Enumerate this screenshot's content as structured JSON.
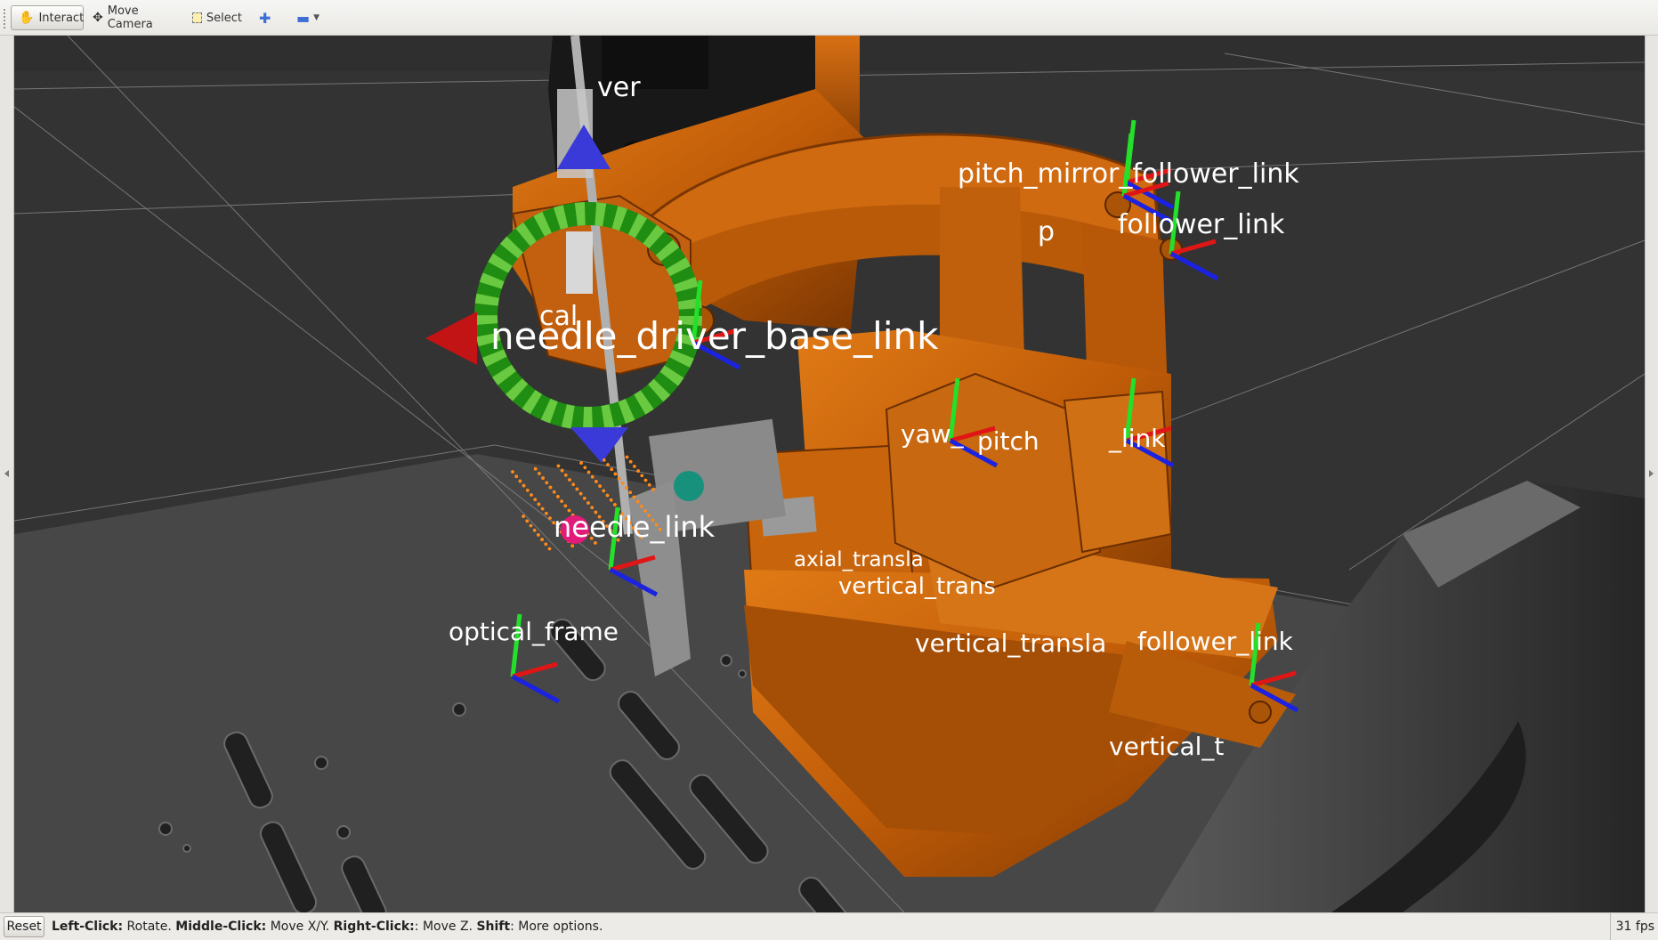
{
  "toolbar": {
    "tools": [
      {
        "label": "Interact",
        "icon": "hand-icon",
        "active": true
      },
      {
        "label": "Move Camera",
        "icon": "move-camera-icon",
        "active": false
      },
      {
        "label": "Select",
        "icon": "select-box-icon",
        "active": false
      }
    ],
    "add_tool_icon": "plus-icon",
    "remove_tool_icon": "minus-icon"
  },
  "viewport": {
    "background_color": "#2f2f2f",
    "robot_color": "#c8640a",
    "frame_labels": [
      {
        "text": "ver"
      },
      {
        "text": "pitch_mirror_follower_link"
      },
      {
        "text": "p"
      },
      {
        "text": "follower_link"
      },
      {
        "text": "cal"
      },
      {
        "text": "needle_driver_base_link"
      },
      {
        "text": "yaw_"
      },
      {
        "text": "pitch"
      },
      {
        "text": "_link"
      },
      {
        "text": "needle_link"
      },
      {
        "text": "axial_transla"
      },
      {
        "text": "vertical_trans"
      },
      {
        "text": "optical_frame"
      },
      {
        "text": "vertical_transla"
      },
      {
        "text": "follower_link"
      },
      {
        "text": "vertical_t"
      }
    ]
  },
  "statusbar": {
    "reset_label": "Reset",
    "left_click_key": "Left-Click:",
    "left_click_action": " Rotate. ",
    "middle_click_key": "Middle-Click:",
    "middle_click_action": " Move X/Y. ",
    "right_click_key": "Right-Click:",
    "right_click_action": ": Move Z. ",
    "shift_key": "Shift",
    "shift_action": ": More options.",
    "fps": "31 fps"
  }
}
